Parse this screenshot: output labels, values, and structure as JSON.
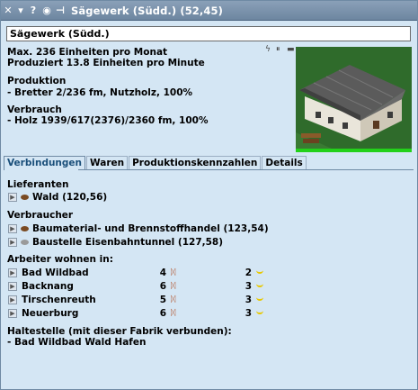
{
  "window": {
    "title": "Sägewerk (Südd.) (52,45)",
    "icons": [
      "close-icon",
      "menu-icon",
      "help-icon",
      "eye-icon",
      "pin-icon"
    ]
  },
  "name_field": {
    "value": "Sägewerk (Südd.)"
  },
  "info": {
    "capacity": "Max. 236 Einheiten pro Monat",
    "production_rate": "Produziert 13.8 Einheiten pro Minute",
    "production_heading": "Produktion",
    "production_line": " - Bretter 2/236 fm, Nutzholz, 100%",
    "consumption_heading": "Verbrauch",
    "consumption_line": " - Holz 1939/617(2376)/2360 fm, 100%"
  },
  "status_icons": [
    "lightning-icon",
    "pause-icon",
    "minus-icon"
  ],
  "tabs": [
    {
      "label": "Verbindungen",
      "active": true
    },
    {
      "label": "Waren",
      "active": false
    },
    {
      "label": "Produktionskennzahlen",
      "active": false
    },
    {
      "label": "Details",
      "active": false
    }
  ],
  "connections": {
    "suppliers_heading": "Lieferanten",
    "suppliers": [
      {
        "label": "Wald (120,56)",
        "icon_color": "#7a4a22"
      }
    ],
    "consumers_heading": "Verbraucher",
    "consumers": [
      {
        "label": "Baumaterial- und Brennstoffhandel (123,54)",
        "icon_color": "#7a4a22"
      },
      {
        "label": "Baustelle Eisenbahntunnel (127,58)",
        "icon_color": "#9a9a9a"
      }
    ],
    "workers_heading": "Arbeiter wohnen in:",
    "workers": [
      {
        "town": "Bad Wildbad",
        "workers": "4",
        "passengers": "2"
      },
      {
        "town": "Backnang",
        "workers": "6",
        "passengers": "3"
      },
      {
        "town": "Tirschenreuth",
        "workers": "5",
        "passengers": "3"
      },
      {
        "town": "Neuerburg",
        "workers": "6",
        "passengers": "3"
      }
    ],
    "stops_heading": "Haltestelle (mit dieser Fabrik verbunden):",
    "stops_line": " - Bad Wildbad Wald Hafen"
  },
  "colors": {
    "title_bar": "#7a90aa",
    "background": "#d4e6f4",
    "production_bar": "#23d11a",
    "smile": "#e8c800"
  }
}
